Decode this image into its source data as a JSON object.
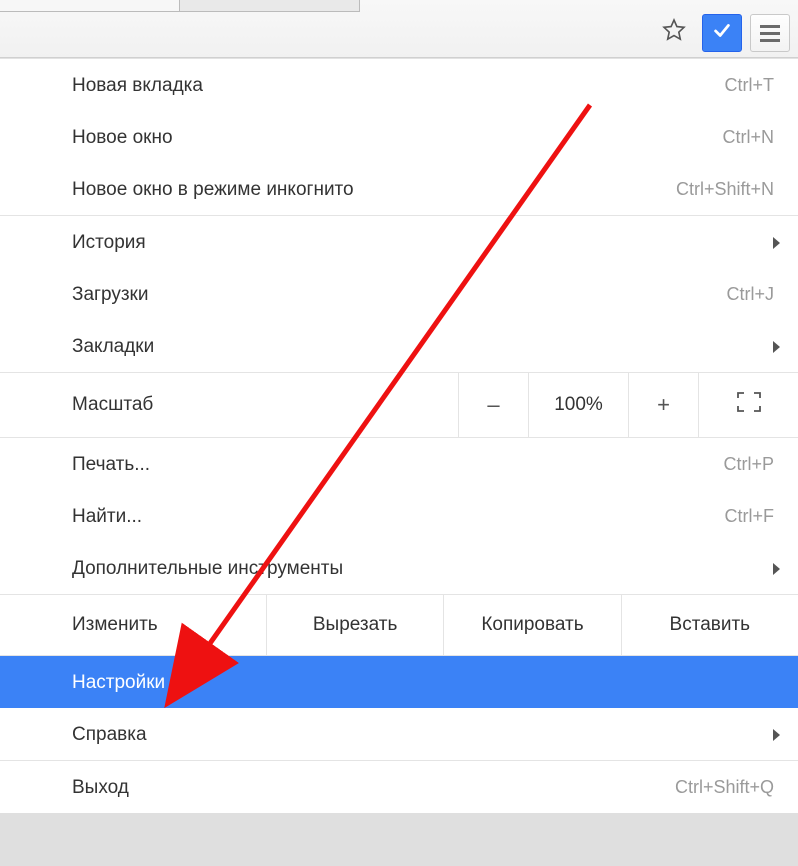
{
  "toolbar": {
    "star_icon": "star-icon",
    "extension_icon": "checkmark-icon",
    "menu_icon": "hamburger-icon"
  },
  "menu": {
    "new_tab": {
      "label": "Новая вкладка",
      "shortcut": "Ctrl+T"
    },
    "new_window": {
      "label": "Новое окно",
      "shortcut": "Ctrl+N"
    },
    "incognito": {
      "label": "Новое окно в режиме инкогнито",
      "shortcut": "Ctrl+Shift+N"
    },
    "history": {
      "label": "История"
    },
    "downloads": {
      "label": "Загрузки",
      "shortcut": "Ctrl+J"
    },
    "bookmarks": {
      "label": "Закладки"
    },
    "zoom": {
      "label": "Масштаб",
      "value": "100%",
      "minus": "–",
      "plus": "+"
    },
    "print": {
      "label": "Печать...",
      "shortcut": "Ctrl+P"
    },
    "find": {
      "label": "Найти...",
      "shortcut": "Ctrl+F"
    },
    "more_tools": {
      "label": "Дополнительные инструменты"
    },
    "edit": {
      "label": "Изменить",
      "cut": "Вырезать",
      "copy": "Копировать",
      "paste": "Вставить"
    },
    "settings": {
      "label": "Настройки"
    },
    "help": {
      "label": "Справка"
    },
    "exit": {
      "label": "Выход",
      "shortcut": "Ctrl+Shift+Q"
    }
  },
  "highlight_color": "#3b82f6"
}
